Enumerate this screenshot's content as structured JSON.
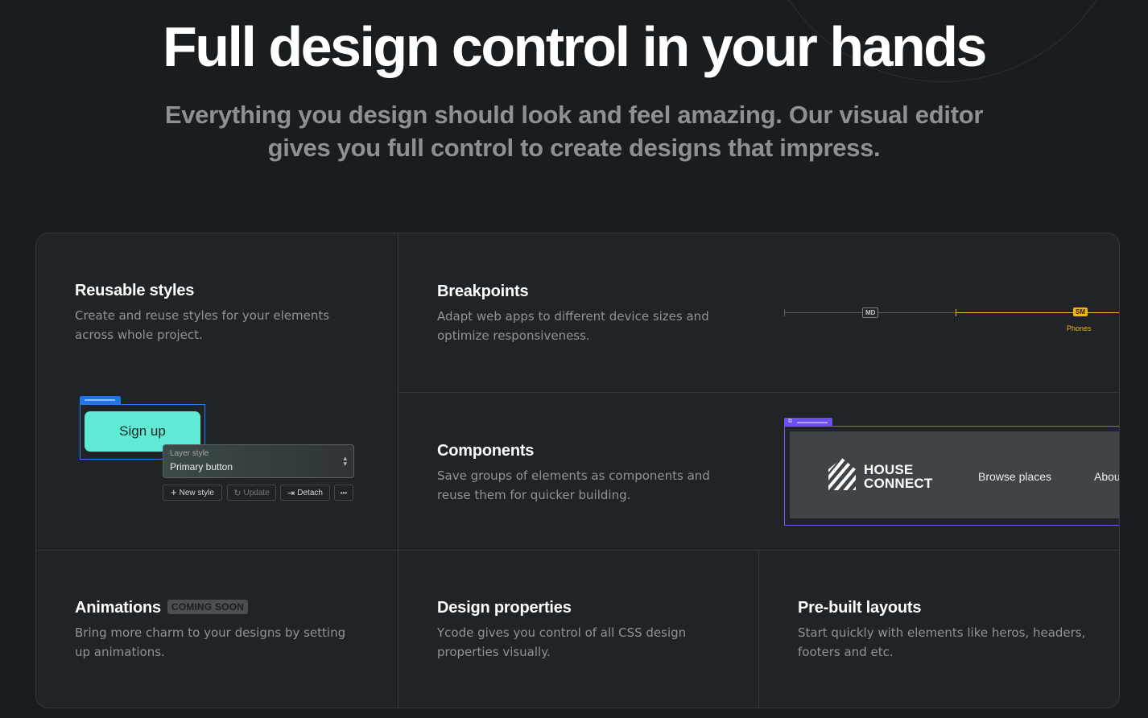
{
  "hero": {
    "title": "Full design control in your hands",
    "subtitle_line1": "Everything you design should look and feel amazing. Our visual editor",
    "subtitle_line2": "gives you full control to create designs that impress."
  },
  "cards": {
    "reusable": {
      "title": "Reusable styles",
      "desc_line1": "Create and reuse styles for your elements",
      "desc_line2": "across whole project.",
      "mock": {
        "button_label": "Sign up",
        "layer_style_label": "Layer style",
        "layer_style_value": "Primary button",
        "new_style": "New style",
        "update": "Update",
        "detach": "Detach",
        "more": "•••"
      }
    },
    "breakpoints": {
      "title": "Breakpoints",
      "desc_line1": "Adapt web apps to different device sizes and",
      "desc_line2": "optimize responsiveness.",
      "mock": {
        "md_tag": "MD",
        "sm_tag": "SM",
        "sm_caption": "Phones"
      }
    },
    "components": {
      "title": "Components",
      "desc_line1": "Save groups of elements as components and",
      "desc_line2": "reuse them for quicker building.",
      "mock": {
        "logo_line1": "HOUSE",
        "logo_line2": "CONNECT",
        "nav_link1": "Browse places",
        "nav_link2": "About"
      }
    },
    "animations": {
      "title": "Animations",
      "badge": "COMING SOON",
      "desc_line1": "Bring more charm to your designs by setting",
      "desc_line2": "up animations."
    },
    "design_properties": {
      "title": "Design properties",
      "desc_line1": "Ycode gives you control of all CSS design",
      "desc_line2": "properties visually."
    },
    "layouts": {
      "title": "Pre-built layouts",
      "desc_line1": "Start quickly with elements like heros, headers,",
      "desc_line2": "footers and etc."
    }
  },
  "colors": {
    "background": "#1a1d1f",
    "card_background": "#202426",
    "accent_teal": "#5eead4",
    "selection_blue": "#2a7af0",
    "breakpoint_yellow": "#f2b418",
    "component_purple": "#7c5cf5"
  },
  "icons": {
    "plus": "plus-icon",
    "refresh": "refresh-icon",
    "detach": "detach-icon",
    "more": "more-icon",
    "component": "component-icon",
    "logo": "house-connect-logo"
  }
}
